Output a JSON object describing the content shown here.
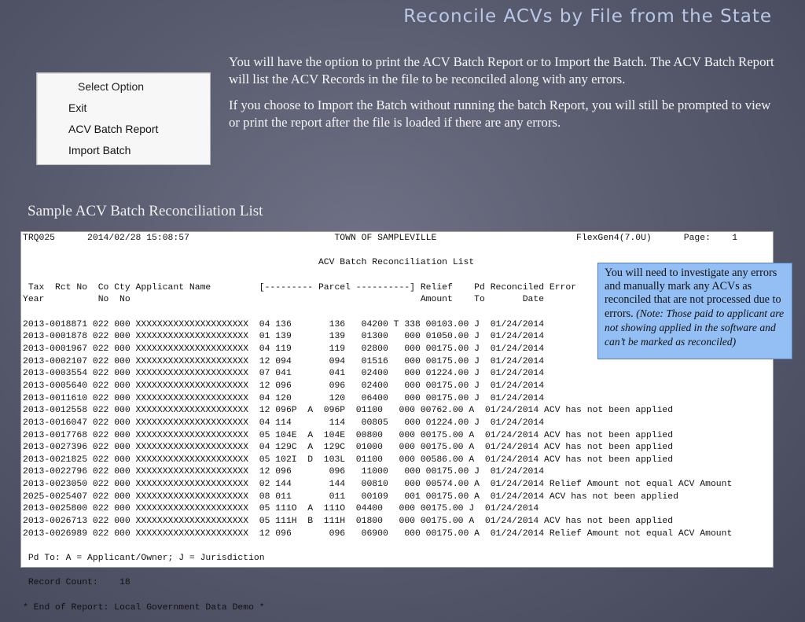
{
  "slide": {
    "title": "Reconcile ACVs by File from the State"
  },
  "menu": {
    "header": "Select Option",
    "items": [
      "Exit",
      "ACV Batch Report",
      "Import Batch"
    ]
  },
  "description": {
    "p1": "You will have the option to print the ACV Batch Report or to Import the Batch.  The ACV Batch Report will list the ACV Records in the file to be reconciled along with any errors.",
    "p2": "If you choose to Import the Batch without running the batch Report, you will still be prompted to view or print the report after the file is loaded if there are any errors."
  },
  "section_title": "Sample ACV Batch Reconciliation List",
  "report": {
    "header_line1": "TRQ025      2014/02/28 15:08:57                           TOWN OF SAMPLEVILLE                          FlexGen4(7.0U)      Page:    1",
    "header_line2": "                                                       ACV Batch Reconciliation List",
    "col_line1": " Tax  Rct No  Co Cty Applicant Name         [--------- Parcel ----------] Relief    Pd Reconciled Error",
    "col_line2": "Year          No  No                                                      Amount    To       Date",
    "rows": [
      "2013-0018871 022 000 XXXXXXXXXXXXXXXXXXXXX  04 136       136   04200 T 338 00103.00 J  01/24/2014",
      "2013-0001878 022 000 XXXXXXXXXXXXXXXXXXXXX  01 139       139   01300   000 01050.00 J  01/24/2014",
      "2013-0001967 022 000 XXXXXXXXXXXXXXXXXXXXX  04 119       119   02800   000 00175.00 J  01/24/2014",
      "2013-0002107 022 000 XXXXXXXXXXXXXXXXXXXXX  12 094       094   01516   000 00175.00 J  01/24/2014",
      "2013-0003554 022 000 XXXXXXXXXXXXXXXXXXXXX  07 041       041   02400   000 01224.00 J  01/24/2014",
      "2013-0005640 022 000 XXXXXXXXXXXXXXXXXXXXX  12 096       096   02400   000 00175.00 J  01/24/2014",
      "2013-0011610 022 000 XXXXXXXXXXXXXXXXXXXXX  04 120       120   06400   000 00175.00 J  01/24/2014",
      "2013-0012558 022 000 XXXXXXXXXXXXXXXXXXXXX  12 096P  A  096P  01100   000 00762.00 A  01/24/2014 ACV has not been applied",
      "2013-0016047 022 000 XXXXXXXXXXXXXXXXXXXXX  04 114       114   00805   000 01224.00 J  01/24/2014",
      "2013-0017768 022 000 XXXXXXXXXXXXXXXXXXXXX  05 104E  A  104E  00800   000 00175.00 A  01/24/2014 ACV has not been applied",
      "2013-0027396 022 000 XXXXXXXXXXXXXXXXXXXXX  04 129C  A  129C  01000   000 00175.00 A  01/24/2014 ACV has not been applied",
      "2013-0021825 022 000 XXXXXXXXXXXXXXXXXXXXX  05 102I  D  103L  01100   000 00586.00 A  01/24/2014 ACV has not been applied",
      "2013-0022796 022 000 XXXXXXXXXXXXXXXXXXXXX  12 096       096   11000   000 00175.00 J  01/24/2014",
      "2013-0023050 022 000 XXXXXXXXXXXXXXXXXXXXX  02 144       144   00810   000 00574.00 A  01/24/2014 Relief Amount not equal ACV Amount",
      "2025-0025407 022 000 XXXXXXXXXXXXXXXXXXXXX  08 011       011   00109   001 00175.00 A  01/24/2014 ACV has not been applied",
      "2013-0025800 022 000 XXXXXXXXXXXXXXXXXXXXX  05 111O  A  111O  04400   000 00175.00 J  01/24/2014",
      "2013-0026713 022 000 XXXXXXXXXXXXXXXXXXXXX  05 111H  B  111H  01800   000 00175.00 A  01/24/2014 ACV has not been applied",
      "2013-0026989 022 000 XXXXXXXXXXXXXXXXXXXXX  12 096       096   06900   000 00175.00 A  01/24/2014 Relief Amount not equal ACV Amount"
    ],
    "legend": " Pd To: A = Applicant/Owner; J = Jurisdiction",
    "record_count": " Record Count:    18",
    "end": "* End of Report: Local Government Data Demo *"
  },
  "callout": {
    "text": "You will need to investigate any errors and manually mark any ACVs as reconciled that are not processed due to errors.",
    "note": "(Note: Those paid to applicant are not showing applied in the software and can’t be marked as reconciled)"
  }
}
